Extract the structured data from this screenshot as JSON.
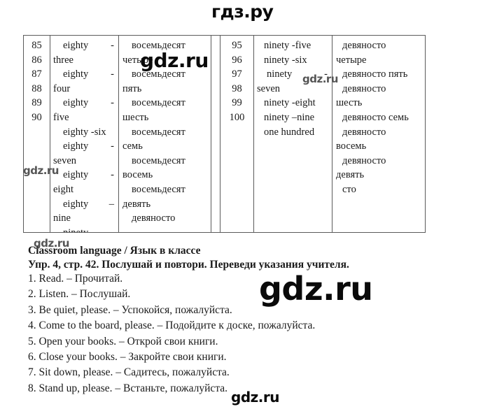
{
  "watermarks": {
    "top": "гдз.ру",
    "table_big": "gdz.ru",
    "table_mid": "gdz.ru",
    "table_left": "gdz.ru",
    "below_table": "gdz.ru",
    "huge": "gdz.ru",
    "bottom": "gdz.ru"
  },
  "tables": {
    "left": {
      "numbers": [
        "85",
        "86",
        "87",
        "88",
        "89",
        "90",
        "",
        "",
        "",
        "",
        "",
        "",
        "",
        ""
      ],
      "words": [
        {
          "text": "eighty",
          "dash": "-",
          "indent": true
        },
        {
          "text": "three",
          "dash": "",
          "indent": false
        },
        {
          "text": "eighty",
          "dash": "-",
          "indent": true
        },
        {
          "text": "four",
          "dash": "",
          "indent": false
        },
        {
          "text": "eighty",
          "dash": "-",
          "indent": true
        },
        {
          "text": "five",
          "dash": "",
          "indent": false
        },
        {
          "text": "eighty -six",
          "dash": "",
          "indent": true
        },
        {
          "text": "eighty",
          "dash": "-",
          "indent": true
        },
        {
          "text": "seven",
          "dash": "",
          "indent": false
        },
        {
          "text": "eighty",
          "dash": "-",
          "indent": false
        },
        {
          "text": "eight",
          "dash": "",
          "indent": false
        },
        {
          "text": "eighty",
          "dash": "–",
          "indent": true
        },
        {
          "text": "nine",
          "dash": "",
          "indent": false
        },
        {
          "text": "ninety",
          "dash": "",
          "indent": true
        }
      ],
      "russian": [
        {
          "text": "восемьдесят",
          "indent": true
        },
        {
          "text": "четыре",
          "indent": false
        },
        {
          "text": "восемьдесят",
          "indent": true
        },
        {
          "text": "пять",
          "indent": false
        },
        {
          "text": "восемьдесят",
          "indent": true
        },
        {
          "text": "шесть",
          "indent": false
        },
        {
          "text": "восемьдесят",
          "indent": true
        },
        {
          "text": "семь",
          "indent": false
        },
        {
          "text": "восемьдесят",
          "indent": true
        },
        {
          "text": "восемь",
          "indent": false
        },
        {
          "text": "восемьдесят",
          "indent": true
        },
        {
          "text": "девять",
          "indent": false
        },
        {
          "text": "девяносто",
          "indent": true
        },
        {
          "text": "",
          "indent": false
        }
      ]
    },
    "right": {
      "numbers": [
        "95",
        "96",
        "97",
        "98",
        "99",
        "100",
        ""
      ],
      "words": [
        {
          "text": "ninety -five",
          "dash": "",
          "indent": true
        },
        {
          "text": "ninety -six",
          "dash": "",
          "indent": true
        },
        {
          "text": "ninety",
          "dash": "-",
          "indent": true
        },
        {
          "text": "seven",
          "dash": "",
          "indent": false
        },
        {
          "text": "ninety -eight",
          "dash": "",
          "indent": true
        },
        {
          "text": "ninety –nine",
          "dash": "",
          "indent": true
        },
        {
          "text": "one hundred",
          "dash": "",
          "indent": true
        }
      ],
      "russian": [
        {
          "text": "девяносто",
          "indent": true
        },
        {
          "text": "четыре",
          "indent": false
        },
        {
          "text": "девяносто пять",
          "indent": true
        },
        {
          "text": "девяносто",
          "indent": true
        },
        {
          "text": "шесть",
          "indent": false
        },
        {
          "text": "девяносто семь",
          "indent": true
        },
        {
          "text": "девяносто",
          "indent": true
        },
        {
          "text": "восемь",
          "indent": false
        },
        {
          "text": "девяносто",
          "indent": true
        },
        {
          "text": "девять",
          "indent": false
        },
        {
          "text": "сто",
          "indent": true
        }
      ]
    }
  },
  "content": {
    "section_title": "Classroom language / Язык в классе",
    "exercise_title": "Упр. 4, стр. 42. Послушай и повтори. Переведи указания учителя.",
    "items": [
      "1. Read. – Прочитай.",
      "2. Listen. – Послушай.",
      "3. Be quiet, please. – Успокойся, пожалуйста.",
      "4. Come to the board, please. – Подойдите к доске, пожалуйста.",
      "5. Open your books. – Открой свои книги.",
      "6. Close your books. – Закройте свои книги.",
      "7. Sit down, please. – Садитесь, пожалуйста.",
      "8. Stand up, please. – Встаньте, пожалуйста."
    ]
  }
}
